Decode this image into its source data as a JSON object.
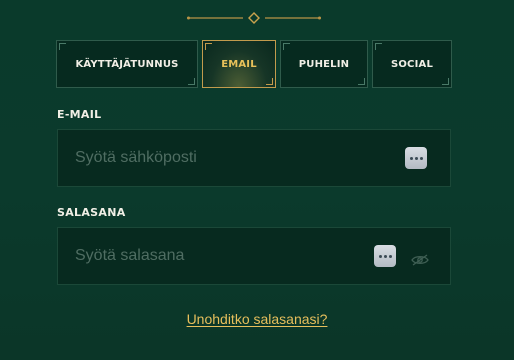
{
  "tabs": [
    {
      "label": "KÄYTTÄJÄTUNNUS",
      "active": false
    },
    {
      "label": "EMAIL",
      "active": true
    },
    {
      "label": "PUHELIN",
      "active": false
    },
    {
      "label": "SOCIAL",
      "active": false
    }
  ],
  "email": {
    "label": "E-MAIL",
    "value": "",
    "placeholder": "Syötä sähköposti"
  },
  "password": {
    "label": "SALASANA",
    "value": "",
    "placeholder": "Syötä salasana"
  },
  "forgot_link": "Unohditko salasanasi?",
  "icons": {
    "ornament": "divider-diamond-ornament",
    "password_manager": "password-manager-dots-icon",
    "visibility": "eye-slash-icon"
  },
  "colors": {
    "background": "#0a3a2b",
    "accent_gold": "#e8c15a",
    "text": "#f1efe6",
    "input_bg": "#072a1f"
  }
}
